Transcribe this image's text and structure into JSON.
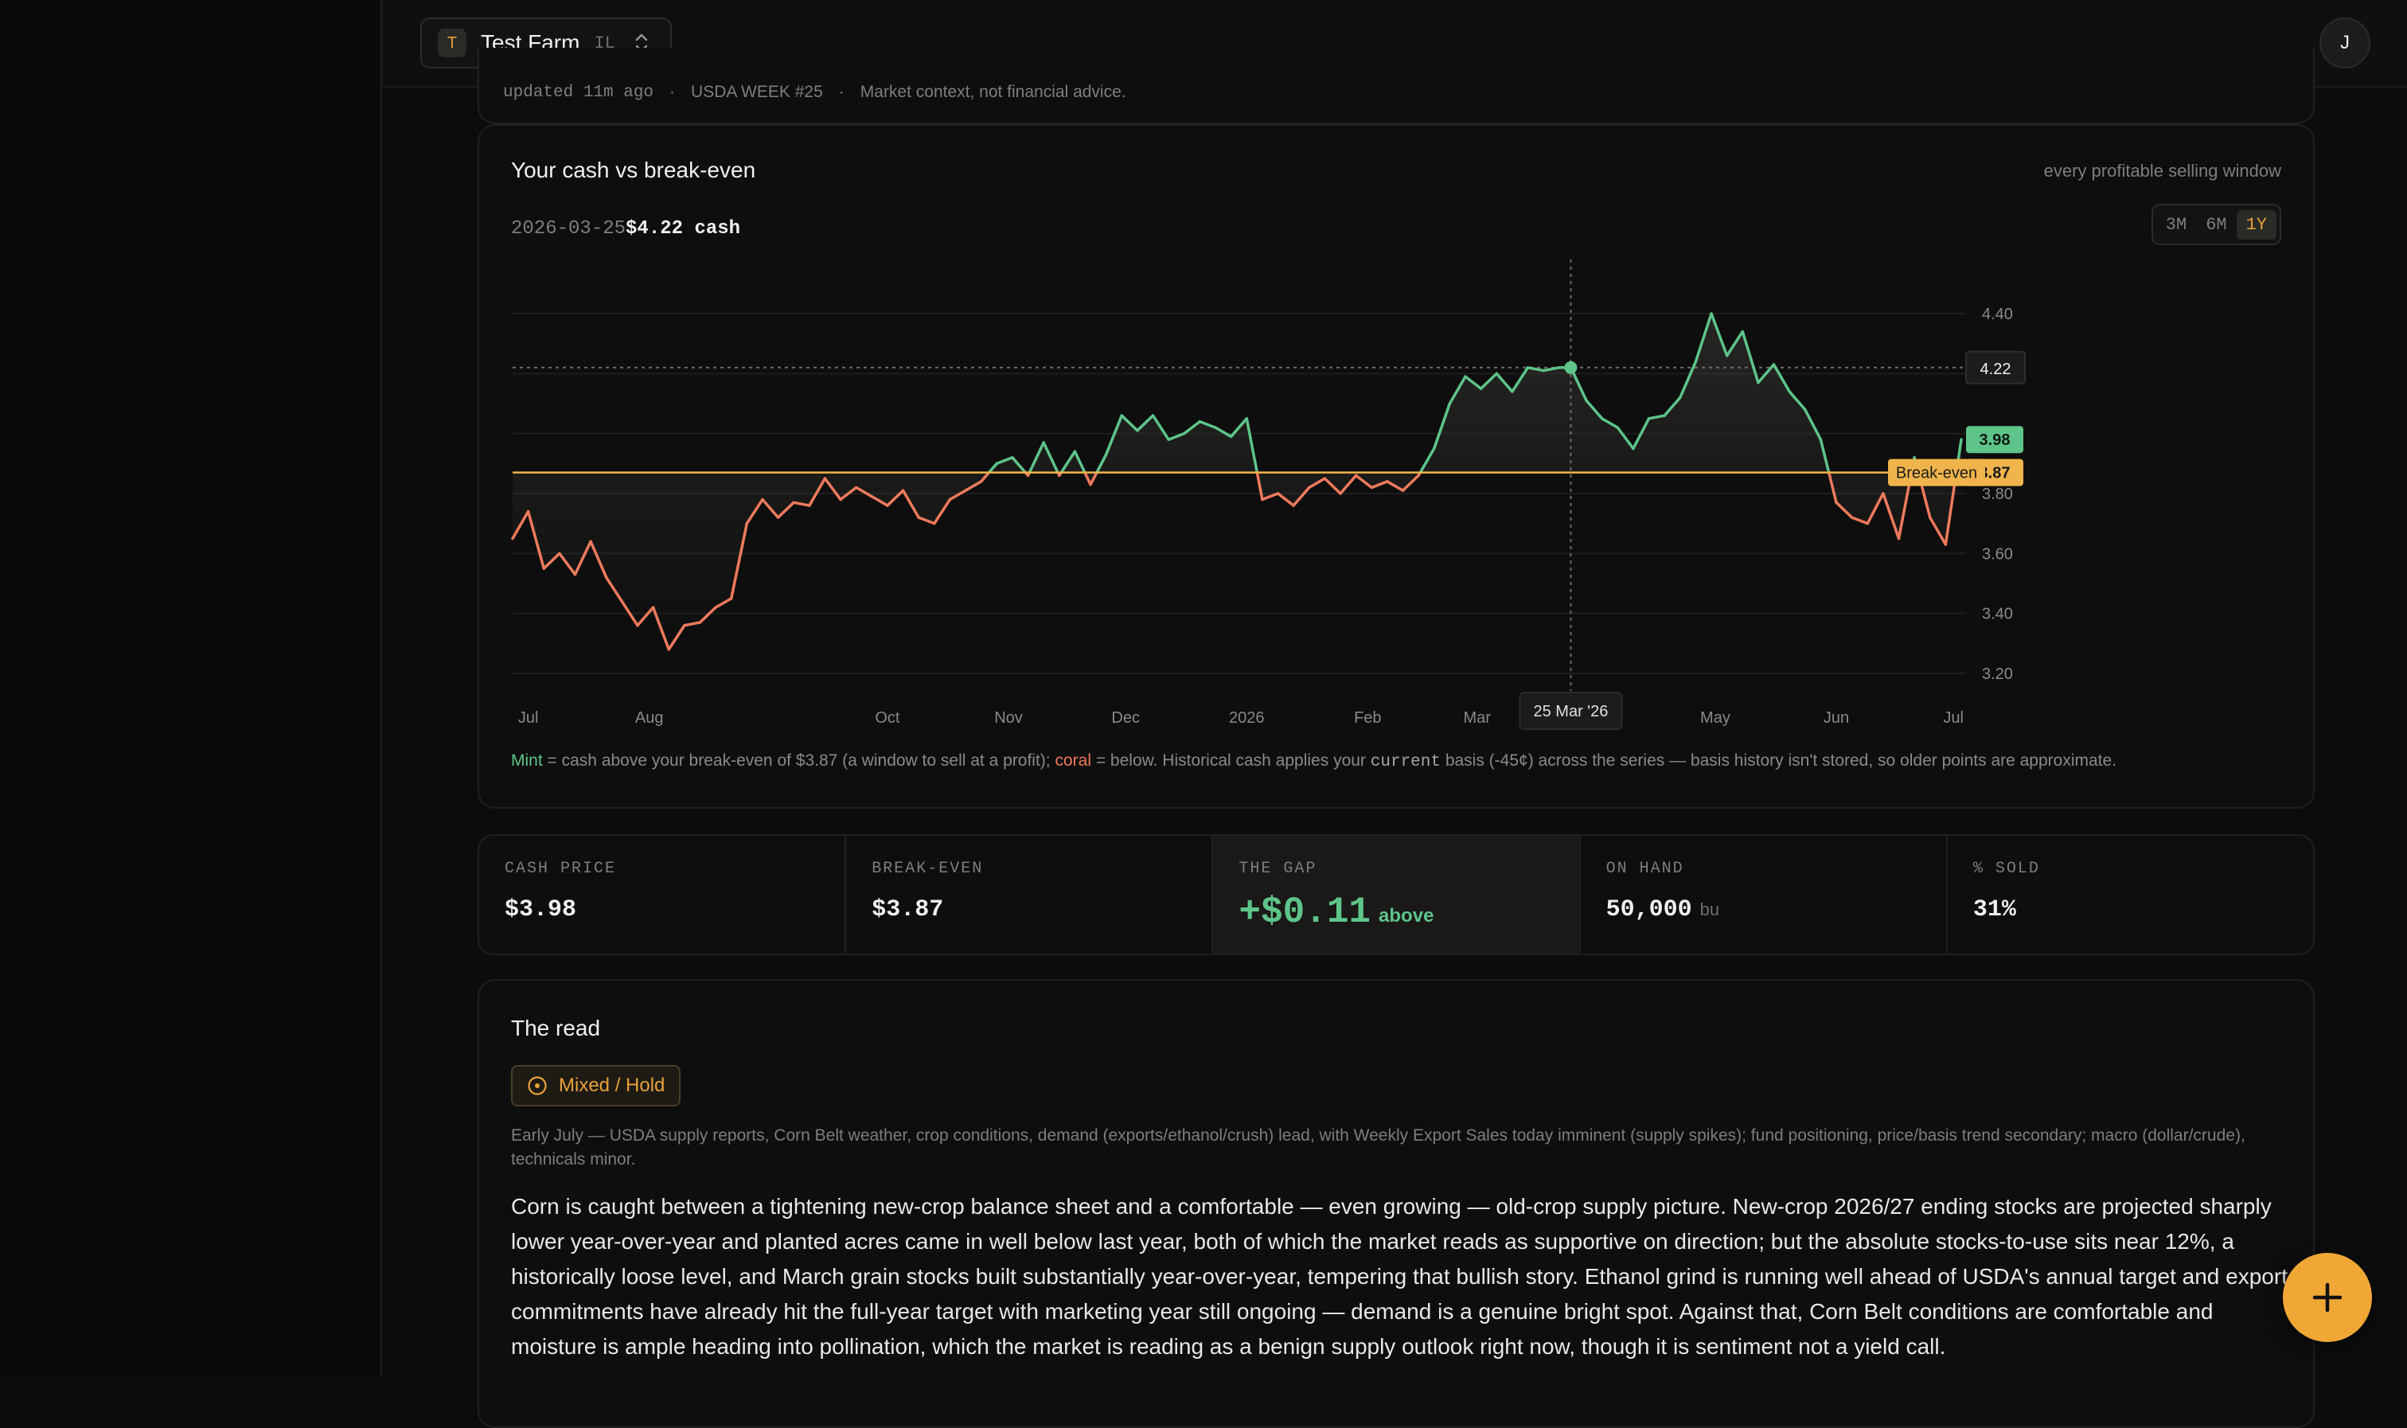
{
  "topbar": {
    "farm_badge": "T",
    "farm_name": "Test Farm",
    "farm_state": "IL",
    "user_initial": "J"
  },
  "meta": {
    "updated": "updated 11m ago",
    "sep1": "·",
    "week": "USDA WEEK #25",
    "sep2": "·",
    "disclaimer": "Market context, not financial advice."
  },
  "chart_card": {
    "title": "Your cash vs break-even",
    "subtitle": "every profitable selling window",
    "readout_date": "2026-03-25",
    "readout_value": "$4.22 cash",
    "range_options": [
      "3M",
      "6M",
      "1Y"
    ],
    "active_range": "1Y",
    "note_mint": "Mint",
    "note_part1": " = cash above your break-even of $3.87 (a window to sell at a profit); ",
    "note_coral": "coral",
    "note_part2": " = below. Historical cash applies your ",
    "note_current": "current",
    "note_part3": " basis (-45¢) across the series — basis history isn't stored, so older points are approximate."
  },
  "chart_data": {
    "type": "line",
    "xlabel": "",
    "ylabel": "",
    "ylim": [
      3.2,
      4.4
    ],
    "y_ticks": [
      3.2,
      3.4,
      3.6,
      3.8,
      4.0,
      4.2,
      4.4
    ],
    "x_tick_labels": [
      "Jul",
      "Aug",
      "Oct",
      "Nov",
      "Dec",
      "2026",
      "Feb",
      "Mar",
      "May",
      "Jun",
      "Jul"
    ],
    "x_tick_dates": [
      "2025-07-01",
      "2025-08-01",
      "2025-10-01",
      "2025-11-01",
      "2025-12-01",
      "2026-01-01",
      "2026-02-01",
      "2026-03-01",
      "2026-05-01",
      "2026-06-01",
      "2026-07-01"
    ],
    "break_even": 3.87,
    "break_even_label": "Break-even",
    "hover": {
      "date": "2026-03-25",
      "date_label": "25 Mar '26",
      "value": 4.22
    },
    "last_value": 3.98,
    "colors": {
      "above": "#5ec48a",
      "below": "#ee7a5d",
      "break_even": "#f0b44c"
    },
    "x": [
      "2025-06-27",
      "2025-07-01",
      "2025-07-05",
      "2025-07-09",
      "2025-07-13",
      "2025-07-17",
      "2025-07-21",
      "2025-07-25",
      "2025-07-29",
      "2025-08-02",
      "2025-08-06",
      "2025-08-10",
      "2025-08-14",
      "2025-08-18",
      "2025-08-22",
      "2025-08-26",
      "2025-08-30",
      "2025-09-03",
      "2025-09-07",
      "2025-09-11",
      "2025-09-15",
      "2025-09-19",
      "2025-09-23",
      "2025-09-27",
      "2025-10-01",
      "2025-10-05",
      "2025-10-09",
      "2025-10-13",
      "2025-10-17",
      "2025-10-21",
      "2025-10-25",
      "2025-10-29",
      "2025-11-02",
      "2025-11-06",
      "2025-11-10",
      "2025-11-14",
      "2025-11-18",
      "2025-11-22",
      "2025-11-26",
      "2025-11-30",
      "2025-12-04",
      "2025-12-08",
      "2025-12-12",
      "2025-12-16",
      "2025-12-20",
      "2025-12-24",
      "2025-12-28",
      "2026-01-01",
      "2026-01-05",
      "2026-01-09",
      "2026-01-13",
      "2026-01-17",
      "2026-01-21",
      "2026-01-25",
      "2026-01-29",
      "2026-02-02",
      "2026-02-06",
      "2026-02-10",
      "2026-02-14",
      "2026-02-18",
      "2026-02-22",
      "2026-02-26",
      "2026-03-02",
      "2026-03-06",
      "2026-03-10",
      "2026-03-14",
      "2026-03-18",
      "2026-03-22",
      "2026-03-25",
      "2026-03-29",
      "2026-04-02",
      "2026-04-06",
      "2026-04-10",
      "2026-04-14",
      "2026-04-18",
      "2026-04-22",
      "2026-04-26",
      "2026-04-30",
      "2026-05-04",
      "2026-05-08",
      "2026-05-12",
      "2026-05-16",
      "2026-05-20",
      "2026-05-24",
      "2026-05-28",
      "2026-06-01",
      "2026-06-05",
      "2026-06-09",
      "2026-06-13",
      "2026-06-17",
      "2026-06-21",
      "2026-06-25",
      "2026-06-29",
      "2026-07-03"
    ],
    "values": [
      3.65,
      3.74,
      3.55,
      3.6,
      3.53,
      3.64,
      3.52,
      3.44,
      3.36,
      3.42,
      3.28,
      3.36,
      3.37,
      3.42,
      3.45,
      3.7,
      3.78,
      3.72,
      3.77,
      3.76,
      3.85,
      3.78,
      3.82,
      3.79,
      3.76,
      3.81,
      3.72,
      3.7,
      3.78,
      3.81,
      3.84,
      3.9,
      3.92,
      3.86,
      3.97,
      3.86,
      3.94,
      3.83,
      3.93,
      4.06,
      4.01,
      4.06,
      3.98,
      4.0,
      4.04,
      4.02,
      3.99,
      4.05,
      3.78,
      3.8,
      3.76,
      3.82,
      3.85,
      3.8,
      3.86,
      3.82,
      3.84,
      3.81,
      3.86,
      3.95,
      4.1,
      4.19,
      4.15,
      4.2,
      4.14,
      4.22,
      4.21,
      4.22,
      4.22,
      4.11,
      4.05,
      4.02,
      3.95,
      4.05,
      4.06,
      4.12,
      4.24,
      4.4,
      4.26,
      4.34,
      4.17,
      4.23,
      4.14,
      4.08,
      3.98,
      3.77,
      3.72,
      3.7,
      3.8,
      3.65,
      3.92,
      3.72,
      3.63,
      3.98
    ]
  },
  "stats": [
    {
      "label": "CASH PRICE",
      "value": "$3.98",
      "unit": ""
    },
    {
      "label": "BREAK-EVEN",
      "value": "$3.87",
      "unit": ""
    },
    {
      "label": "THE GAP",
      "value": "+$0.11",
      "unit": "above"
    },
    {
      "label": "ON HAND",
      "value": "50,000",
      "unit": "bu"
    },
    {
      "label": "% SOLD",
      "value": "31%",
      "unit": ""
    }
  ],
  "read": {
    "title": "The read",
    "verdict": "Mixed / Hold",
    "context": "Early July — USDA supply reports, Corn Belt weather, crop conditions, demand (exports/ethanol/crush) lead, with Weekly Export Sales today imminent (supply spikes); fund positioning, price/basis trend secondary; macro (dollar/crude), technicals minor.",
    "body": "Corn is caught between a tightening new-crop balance sheet and a comfortable — even growing — old-crop supply picture. New-crop 2026/27 ending stocks are projected sharply lower year-over-year and planted acres came in well below last year, both of which the market reads as supportive on direction; but the absolute stocks-to-use sits near 12%, a historically loose level, and March grain stocks built substantially year-over-year, tempering that bullish story. Ethanol grind is running well ahead of USDA's annual target and export commitments have already hit the full-year target with marketing year still ongoing — demand is a genuine bright spot. Against that, Corn Belt conditions are comfortable and moisture is ample heading into pollination, which the market is reading as a benign supply outlook right now, though it is sentiment not a yield call."
  }
}
